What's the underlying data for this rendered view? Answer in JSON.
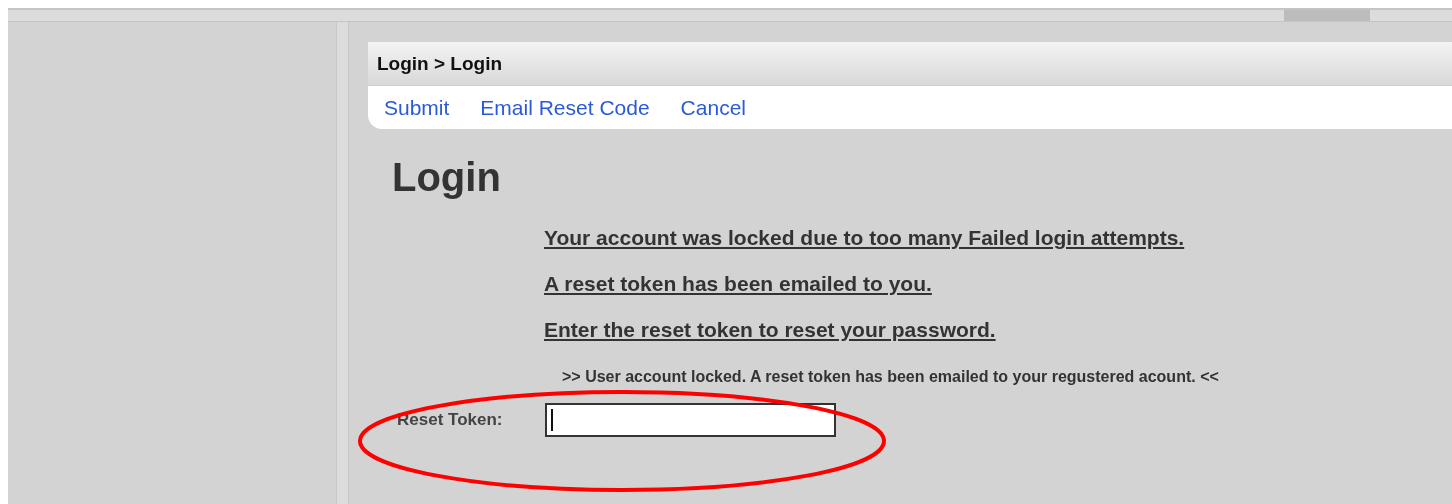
{
  "breadcrumb": "Login > Login",
  "toolbar": [
    "Submit",
    "Email Reset Code",
    "Cancel"
  ],
  "heading": "Login",
  "messages": [
    "Your account was locked due to too many Failed login attempts.",
    "A reset token has been emailed to you.",
    "Enter the reset token to reset your password."
  ],
  "notice": ">> User account locked. A reset token has been emailed to your regustered acount. <<",
  "field": {
    "label": "Reset Token:",
    "focused": true
  }
}
